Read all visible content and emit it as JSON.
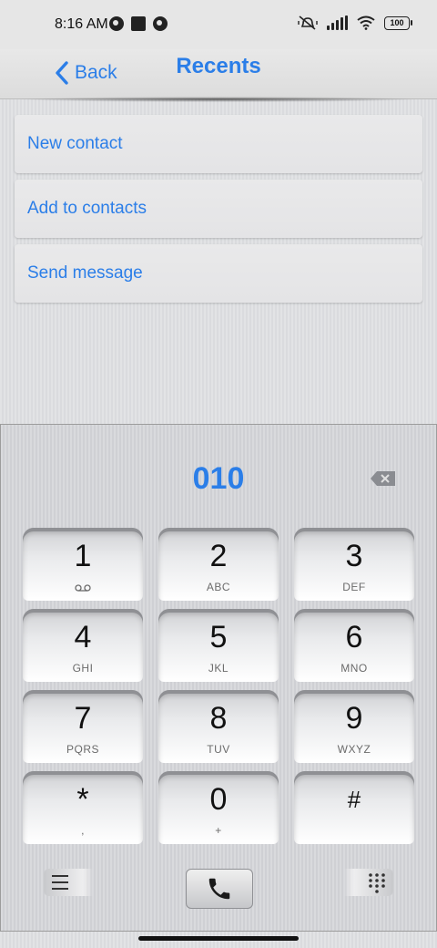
{
  "status_bar": {
    "time": "8:16 AM",
    "battery": "100"
  },
  "header": {
    "back_label": "Back",
    "title": "Recents"
  },
  "options": [
    {
      "label": "New contact"
    },
    {
      "label": "Add to contacts"
    },
    {
      "label": "Send message"
    }
  ],
  "dialer": {
    "number": "010",
    "keys": [
      {
        "digit": "1",
        "letters": ""
      },
      {
        "digit": "2",
        "letters": "ABC"
      },
      {
        "digit": "3",
        "letters": "DEF"
      },
      {
        "digit": "4",
        "letters": "GHI"
      },
      {
        "digit": "5",
        "letters": "JKL"
      },
      {
        "digit": "6",
        "letters": "MNO"
      },
      {
        "digit": "7",
        "letters": "PQRS"
      },
      {
        "digit": "8",
        "letters": "TUV"
      },
      {
        "digit": "9",
        "letters": "WXYZ"
      },
      {
        "digit": "*",
        "letters": ","
      },
      {
        "digit": "0",
        "letters": "+"
      },
      {
        "digit": "#",
        "letters": ""
      }
    ]
  },
  "colors": {
    "accent": "#2b7ee8"
  },
  "icons": {
    "back": "chevron-left-icon",
    "backspace": "backspace-icon",
    "voicemail": "voicemail-icon",
    "menu": "menu-icon",
    "call": "phone-icon",
    "keypad": "keypad-icon"
  }
}
